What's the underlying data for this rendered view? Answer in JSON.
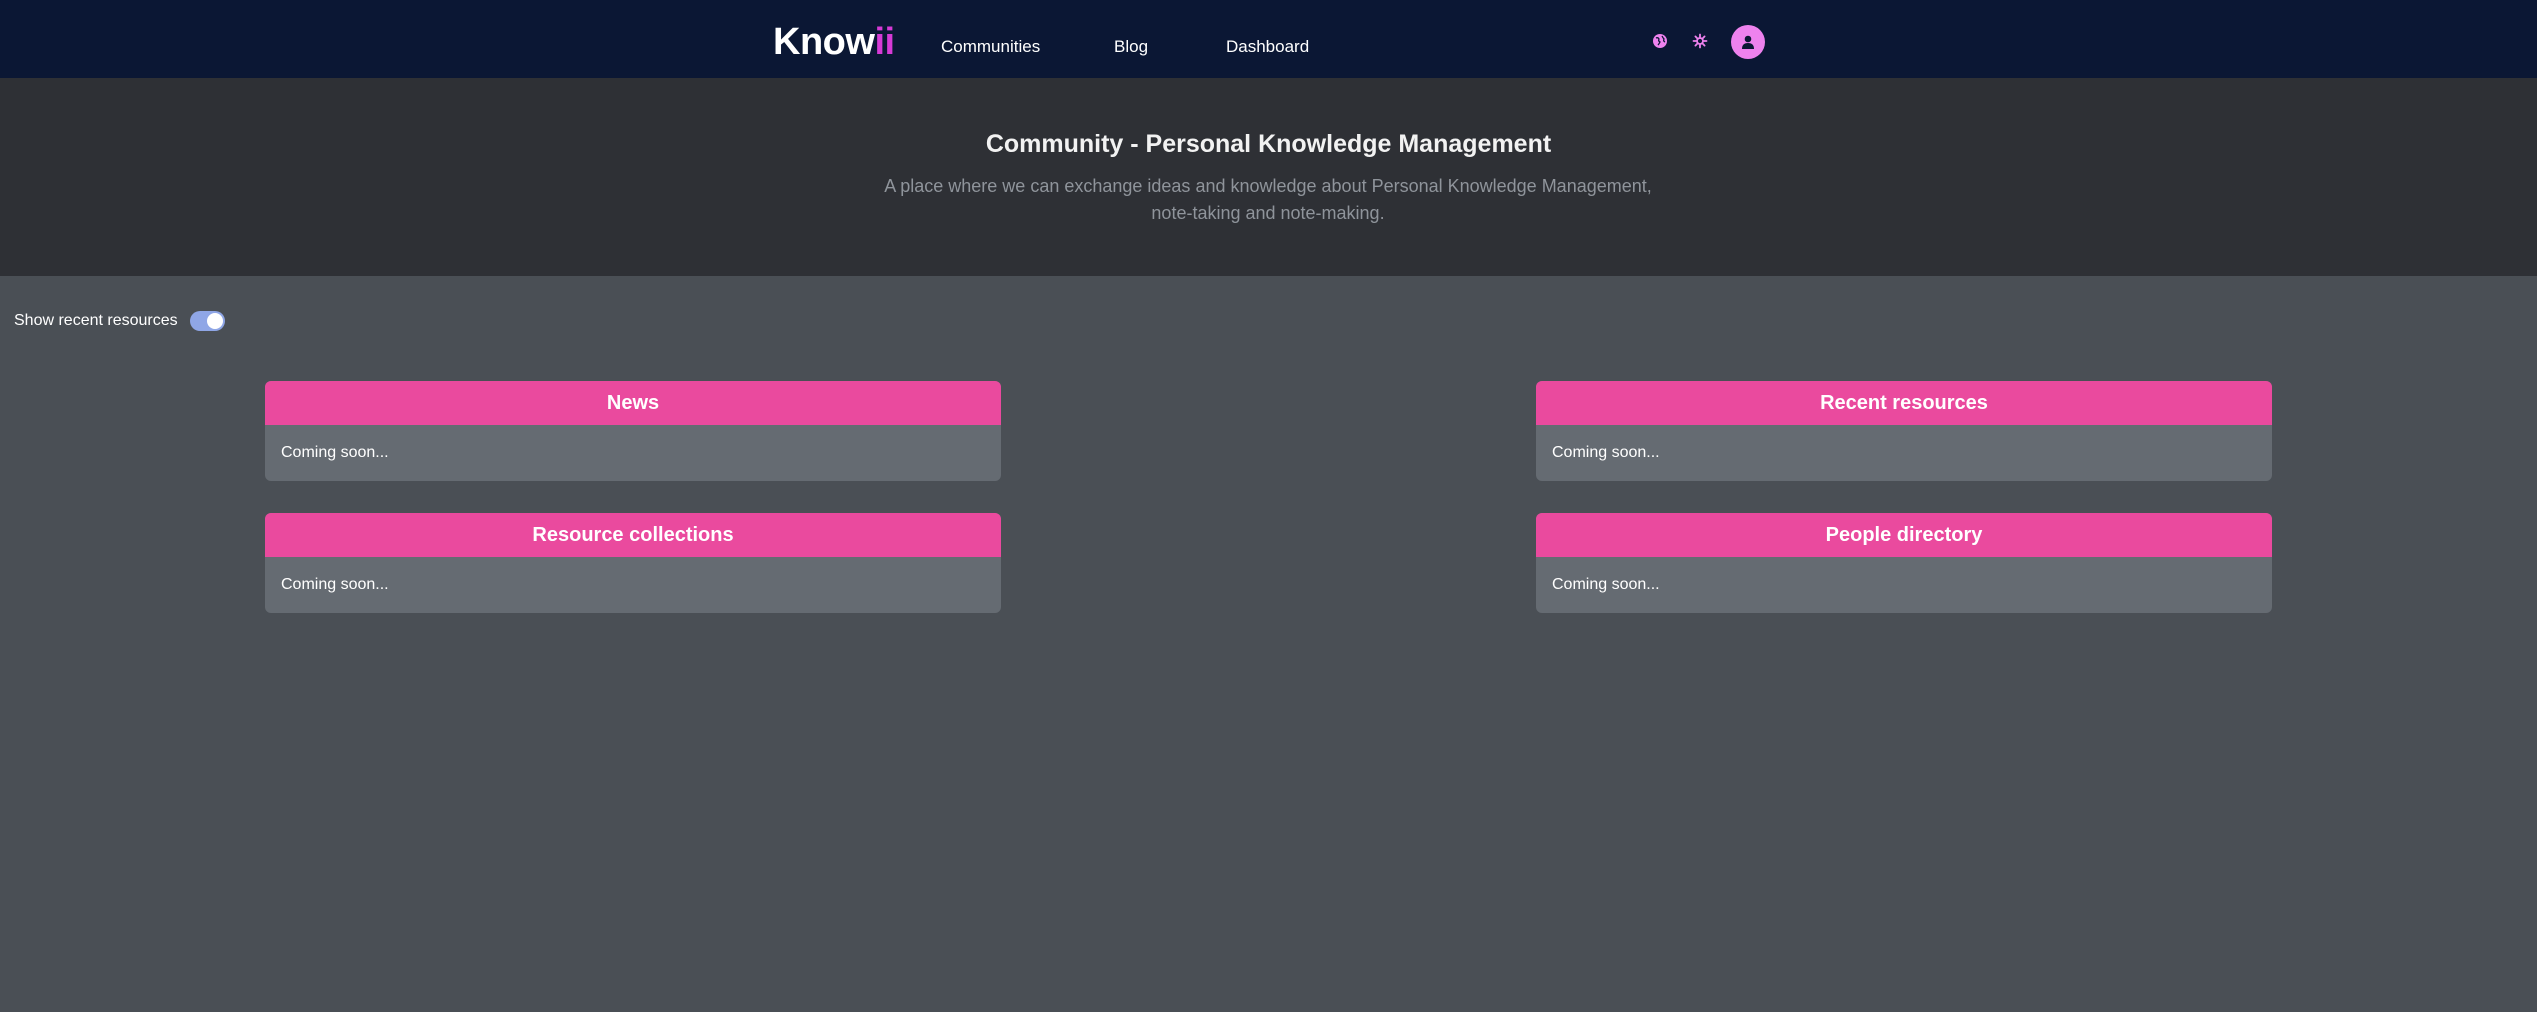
{
  "brand": {
    "logo_main": "Know",
    "logo_accent": "ii",
    "accent_color": "#d63ad6"
  },
  "nav": {
    "links": [
      {
        "label": "Communities"
      },
      {
        "label": "Blog"
      },
      {
        "label": "Dashboard"
      }
    ],
    "icons": [
      "globe-icon",
      "settings-icon",
      "user-icon"
    ]
  },
  "hero": {
    "title": "Community - Personal Knowledge Management",
    "description": "A place where we can exchange ideas and knowledge about Personal Knowledge Management, note-taking and note-making."
  },
  "toggle": {
    "label": "Show recent resources",
    "enabled": true
  },
  "cards": [
    {
      "title": "News",
      "body": "Coming soon..."
    },
    {
      "title": "Recent resources",
      "body": "Coming soon..."
    },
    {
      "title": "Resource collections",
      "body": "Coming soon..."
    },
    {
      "title": "People directory",
      "body": "Coming soon..."
    }
  ],
  "colors": {
    "topbar": "#0b1734",
    "hero": "#2e3035",
    "page": "#4a4f55",
    "card_header": "#ea4a9e",
    "card_body": "#656b72",
    "icon": "#ee82ee"
  }
}
